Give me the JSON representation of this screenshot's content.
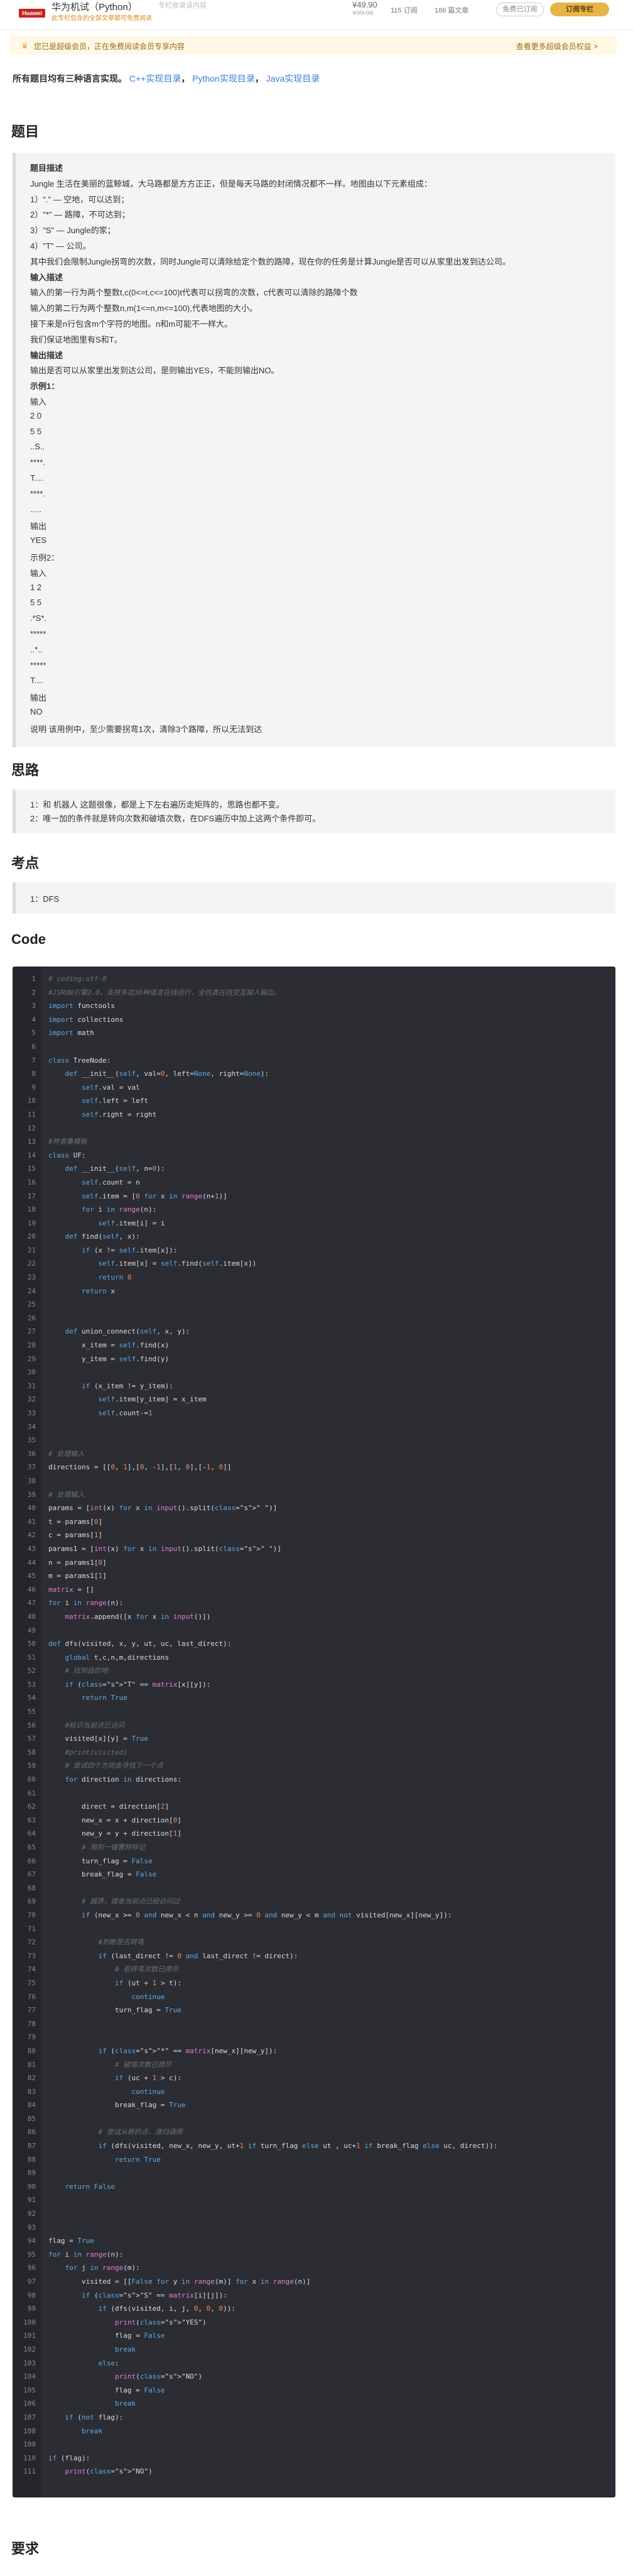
{
  "header": {
    "brand": "Huawei",
    "title": "华为机试（Python）",
    "date": "专栏收录该内容",
    "tag": "此专栏包含的全部文章都可免费阅读",
    "price": "¥49.90",
    "old_price": "¥99.00",
    "stats": [
      "115 订阅",
      "186 篇文章"
    ],
    "free_button": "免费已订阅",
    "subscribe_button": "订阅专栏"
  },
  "notice": {
    "text": "您已是超级会员，正在免费阅读会员专享内容",
    "right": "查看更多超级会员权益 >"
  },
  "intro": {
    "text": "所有题目均有三种语言实现。",
    "links": [
      "C++实现目录",
      "Python实现目录",
      "Java实现目录"
    ]
  },
  "sections": {
    "problem": "题目",
    "idea": "思路",
    "kaodian": "考点",
    "code": "Code",
    "require": "要求"
  },
  "problem_lines": [
    "题目描述",
    "Jungle 生活在美丽的蓝鲸城，大马路都是方方正正，但是每天马路的封闭情况都不一样。地图由以下元素组成：",
    "1）\".\" — 空地，可以达到；",
    "2）\"*\" — 路障，不可达到；",
    "3）\"S\" — Jungle的家；",
    "4）\"T\" — 公司。",
    "其中我们会限制Jungle拐弯的次数，同时Jungle可以清除给定个数的路障，现在你的任务是计算Jungle是否可以从家里出发到达公司。",
    "输入描述",
    "输入的第一行为两个整数t,c(0<=t,c<=100)t代表可以拐弯的次数，c代表可以清除的路障个数",
    "输入的第二行为两个整数n,m(1<=n,m<=100),代表地图的大小。",
    "接下来是n行包含m个字符的地图。n和m可能不一样大。",
    "我们保证地图里有S和T。",
    "输出描述",
    "输出是否可以从家里出发到达公司，是则输出YES，不能则输出NO。",
    "示例1：",
    "输入",
    "2 0",
    "5 5",
    "..S..",
    "****.",
    "T....",
    "****.",
    ".....",
    "输出",
    "YES",
    "示例2：",
    "输入",
    "1 2",
    "5 5",
    ".*S*.",
    "*****",
    "..*..",
    "*****",
    "T....",
    "输出",
    "NO",
    "说明 该用例中，至少需要拐弯1次，清除3个路障，所以无法到达"
  ],
  "idea_lines": [
    "1：和 机器人 这题很像，都是上下左右遍历走矩阵的，思路也都不变。",
    "2：唯一加的条件就是转向次数和破墙次数，在DFS遍历中加上这两个条件即可。"
  ],
  "kaodian_lines": [
    "1：DFS"
  ],
  "code_lines": [
    "# coding:utf-8",
    "#JSRUN引擎2.0，支持多达30种语言在线运行，全仿真在线交互输入输出。",
    "import functools",
    "import collections",
    "import math",
    "",
    "class TreeNode:",
    "    def __init__(self, val=0, left=None, right=None):",
    "        self.val = val",
    "        self.left = left",
    "        self.right = right",
    "",
    "#并查集模板",
    "class UF:",
    "    def __init__(self, n=0):",
    "        self.count = n",
    "        self.item = [0 for x in range(n+1)]",
    "        for i in range(n):",
    "            self.item[i] = i",
    "    def find(self, x):",
    "        if (x != self.item[x]):",
    "            self.item[x] = self.find(self.item[x])",
    "            return 0",
    "        return x",
    "",
    "",
    "    def union_connect(self, x, y):",
    "        x_item = self.find(x)",
    "        y_item = self.find(y)",
    "",
    "        if (x_item != y_item):",
    "            self.item[y_item] = x_item",
    "            self.count-=1",
    "",
    "",
    "# 处理输入",
    "directions = [[0, 1],[0, -1],[1, 0],[-1, 0]]",
    "",
    "# 处理输入",
    "params = [int(x) for x in input().split(\" \")]",
    "t = params[0]",
    "c = params[1]",
    "params1 = [int(x) for x in input().split(\" \")]",
    "n = params1[0]",
    "m = params1[1]",
    "matrix = []",
    "for i in range(n):",
    "    matrix.append([x for x in input()])",
    "",
    "def dfs(visited, x, y, ut, uc, last_direct):",
    "    global t,c,n,m,directions",
    "    # 找到目的地",
    "    if (\"T\" == matrix[x][y]):",
    "        return True",
    "",
    "    #标识当前点已访问",
    "    visited[x][y] = True",
    "    #print(visited)",
    "    # 尝试四个方向去寻找下一个点",
    "    for direction in directions:",
    "",
    "        direct = direction[2]",
    "        new_x = x + direction[0]",
    "        new_y = y + direction[1]",
    "        # 用到一键置转标记",
    "        turn_flag = False",
    "        break_flag = False",
    "",
    "        # 越界，或者当前点已经访问过",
    "        if (new_x >= 0 and new_x < n and new_y >= 0 and new_y < m and not visited[new_x][new_y]):",
    "",
    "            #判断是否转弯",
    "            if (last_direct != 0 and last_direct != direct):",
    "                # 若转弯次数已用尽",
    "                if (ut + 1 > t):",
    "                    continue",
    "                turn_flag = True",
    "",
    "",
    "            if (\"*\" == matrix[new_x][new_y]):",
    "                # 破墙次数已用尽",
    "                if (uc + 1 > c):",
    "                    continue",
    "                break_flag = True",
    "",
    "            # 尝试从新的点，递归调用",
    "            if (dfs(visited, new_x, new_y, ut+1 if turn_flag else ut , uc+1 if break_flag else uc, direct)):",
    "                return True",
    "",
    "    return False",
    "",
    "",
    "",
    "flag = True",
    "for i in range(n):",
    "    for j in range(m):",
    "        visited = [[False for y in range(m)] for x in range(n)]",
    "        if (\"S\" == matrix[i][j]):",
    "            if (dfs(visited, i, j, 0, 0, 0)):",
    "                print(\"YES\")",
    "                flag = False",
    "                break",
    "            else:",
    "                print(\"NO\")",
    "                flag = False",
    "                break",
    "    if (not flag):",
    "        break",
    "",
    "if (flag):",
    "    print(\"NO\")"
  ]
}
